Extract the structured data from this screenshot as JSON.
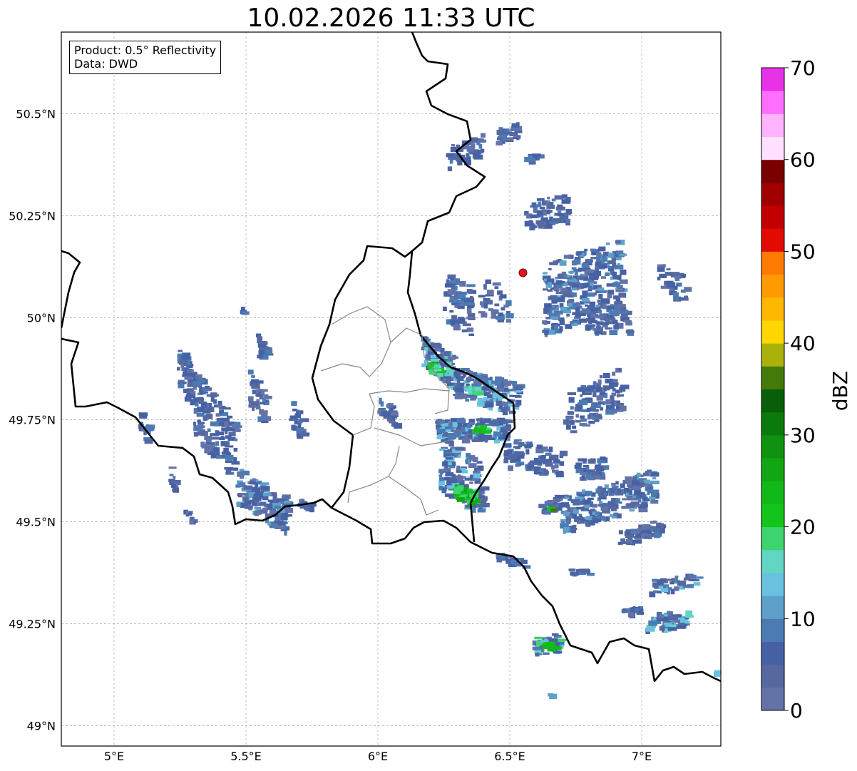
{
  "title": "10.02.2026 11:33 UTC",
  "info": {
    "product_line": "Product: 0.5° Reflectivity",
    "data_line": "Data: DWD"
  },
  "axes": {
    "lon_ticks": [
      {
        "value": 5.0,
        "label": "5°E"
      },
      {
        "value": 5.5,
        "label": "5.5°E"
      },
      {
        "value": 6.0,
        "label": "6°E"
      },
      {
        "value": 6.5,
        "label": "6.5°E"
      },
      {
        "value": 7.0,
        "label": "7°E"
      }
    ],
    "lat_ticks": [
      {
        "value": 49.0,
        "label": "49°N"
      },
      {
        "value": 49.25,
        "label": "49.25°N"
      },
      {
        "value": 49.5,
        "label": "49.5°N"
      },
      {
        "value": 49.75,
        "label": "49.75°N"
      },
      {
        "value": 50.0,
        "label": "50°N"
      },
      {
        "value": 50.25,
        "label": "50.25°N"
      },
      {
        "value": 50.5,
        "label": "50.5°N"
      }
    ],
    "lon_range": [
      4.8,
      7.3
    ],
    "lat_range": [
      48.95,
      50.7
    ],
    "grid": true
  },
  "radar_site": {
    "lon": 6.55,
    "lat": 50.11,
    "color": "#e8141c"
  },
  "colorbar": {
    "unit": "dBZ",
    "min": 0,
    "max": 70,
    "tick_labels": [
      "0",
      "10",
      "20",
      "30",
      "40",
      "50",
      "60",
      "70"
    ],
    "colors": [
      "#6373a8",
      "#5568a0",
      "#4762a4",
      "#4b7bb3",
      "#5ea0c9",
      "#68c1df",
      "#62d5c3",
      "#3dd36f",
      "#12c41c",
      "#12b81a",
      "#12a614",
      "#0f9210",
      "#0b7a0c",
      "#095e09",
      "#437a0a",
      "#aab20a",
      "#ffd600",
      "#ffb800",
      "#ff9a00",
      "#ff7a00",
      "#e30a00",
      "#c20000",
      "#a00000",
      "#7a0000",
      "#ffe0ff",
      "#ffb3ff",
      "#ff6eff",
      "#e832e8"
    ]
  },
  "colors": {
    "border_heavy": "#000000",
    "border_light": "#888888",
    "grid": "#aaaaaa"
  }
}
